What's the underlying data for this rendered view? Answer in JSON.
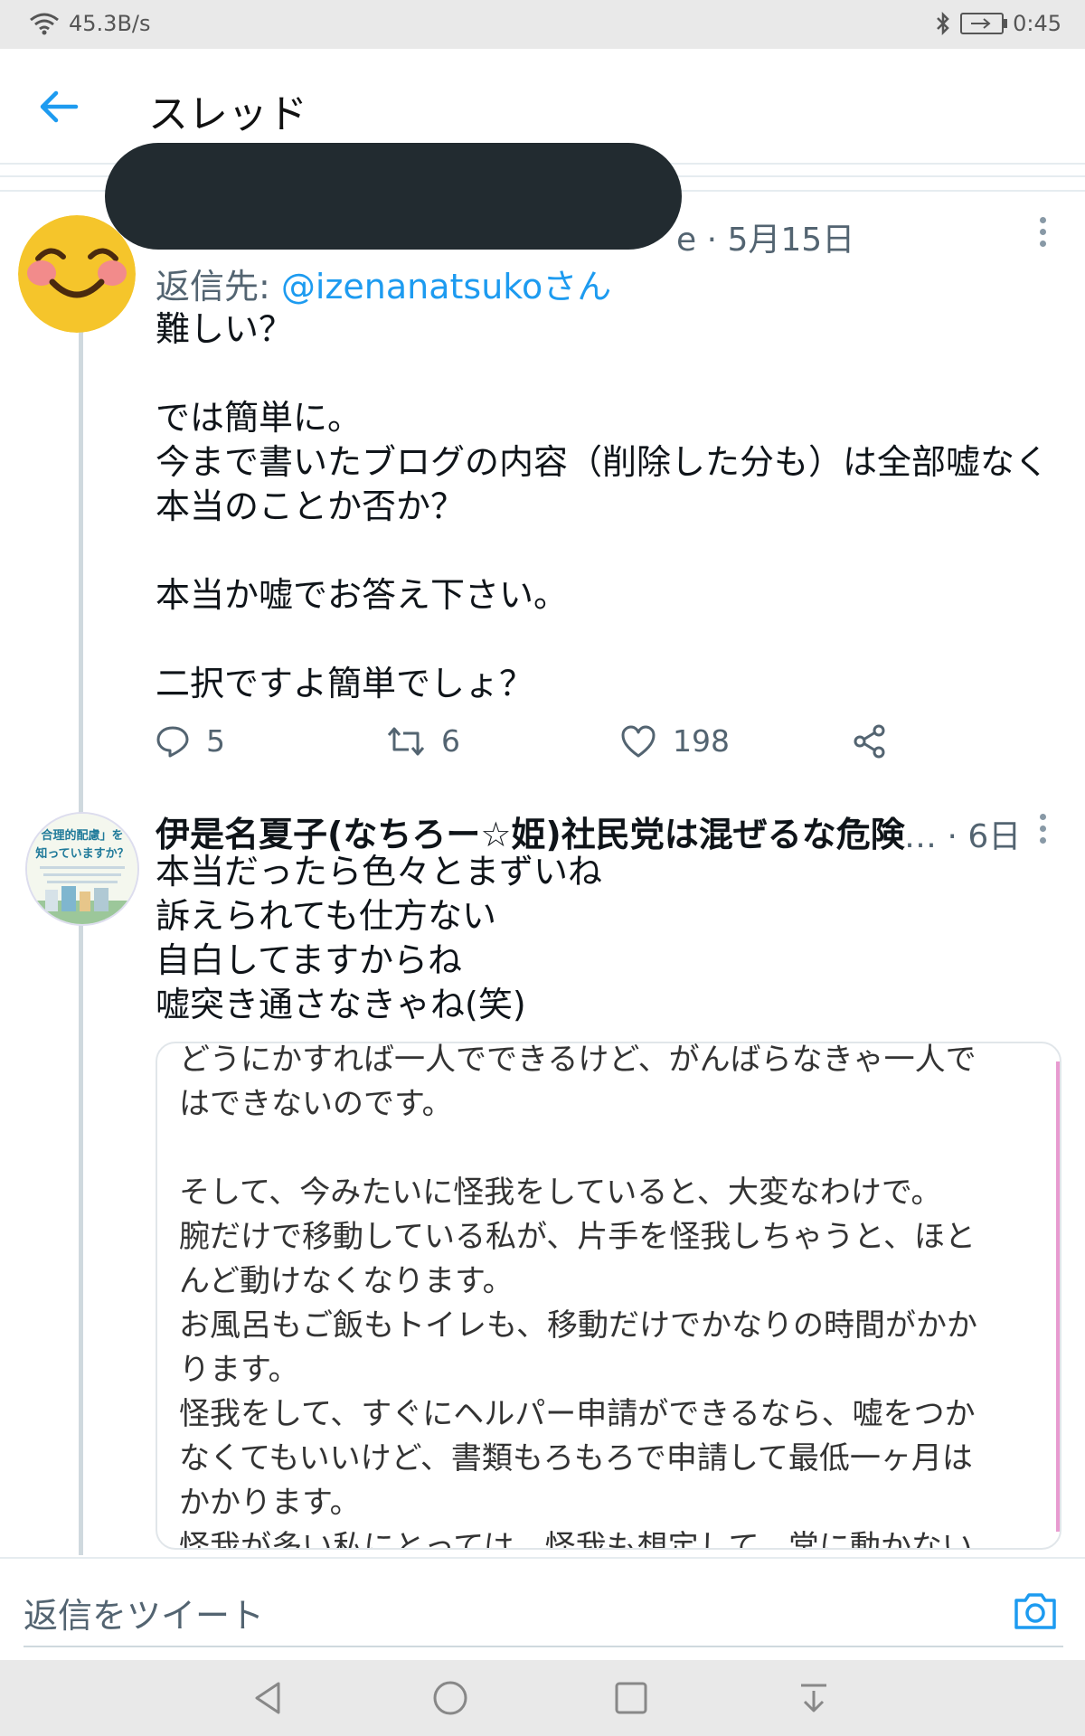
{
  "status_bar": {
    "network_speed": "45.3B/s",
    "time": "0:45",
    "wifi_icon": "wifi-icon",
    "bluetooth_icon": "bluetooth-icon",
    "battery_icon": "battery-charging-icon"
  },
  "header": {
    "title": "スレッド",
    "back_icon": "arrow-left-icon"
  },
  "tweet1": {
    "meta": "e · 5月15日",
    "reply_to_prefix": "返信先: ",
    "reply_to_handle": "@izenanatsukoさん",
    "lines": [
      "難しい？",
      "",
      "では簡単に。",
      "今まで書いたブログの内容（削除した分も）は全部嘘なく",
      "本当のことか否か？",
      "",
      "本当か嘘でお答え下さい。",
      "",
      "二択ですよ簡単でしょ？"
    ],
    "reply_count": "5",
    "retweet_count": "6",
    "like_count": "198"
  },
  "tweet2": {
    "display_name": "伊是名夏子(なちろー☆姫)社民党は混ぜるな危険",
    "ellipsis": "…",
    "meta": "· 6日",
    "avatar_text_1": "合理的配慮」を",
    "avatar_text_2": "知っていますか？",
    "lines": [
      "本当だったら色々とまずいね",
      "訴えられても仕方ない",
      "自白してますからね",
      "嘘突き通さなきゃね(笑)"
    ],
    "image_lines": [
      "どうにかすれば一人でできるけど、がんばらなきゃ一人で",
      "はできないのです。",
      "",
      "そして、今みたいに怪我をしていると、大変なわけで。",
      "腕だけで移動している私が、片手を怪我しちゃうと、ほと",
      "んど動けなくなります。",
      "お風呂もご飯もトイレも、移動だけでかなりの時間がかか",
      "ります。",
      "怪我をして、すぐにヘルパー申請ができるなら、嘘をつか",
      "なくてもいいけど、書類もろもろで申請して最低一ヶ月は",
      "かかります。",
      "怪我が多い私にとっては、怪我も想定して、常に動かない"
    ]
  },
  "compose": {
    "placeholder": "返信をツイート",
    "camera_icon": "camera-icon"
  },
  "nav": {
    "back": "nav-back-icon",
    "home": "nav-home-icon",
    "recents": "nav-recents-icon",
    "notifications": "nav-pulldown-icon"
  },
  "colors": {
    "accent": "#1d9bf0",
    "secondary_text": "#536471",
    "redaction": "#222b30"
  }
}
